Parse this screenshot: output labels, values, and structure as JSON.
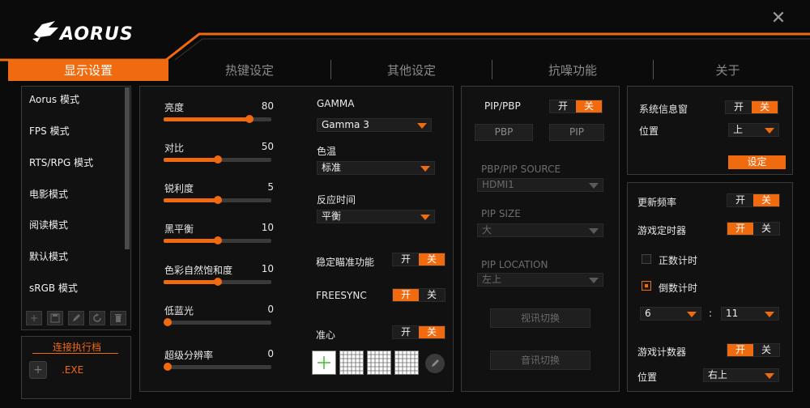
{
  "app": {
    "logo": "AORUS",
    "close_icon": "✕"
  },
  "tabs": [
    {
      "label": "显示设置",
      "active": true
    },
    {
      "label": "热键设定",
      "active": false
    },
    {
      "label": "其他设定",
      "active": false
    },
    {
      "label": "抗噪功能",
      "active": false
    },
    {
      "label": "关于",
      "active": false
    }
  ],
  "modes": [
    "Aorus 模式",
    "FPS 模式",
    "RTS/RPG 模式",
    "电影模式",
    "阅读模式",
    "默认模式",
    "sRGB 模式"
  ],
  "mode_tools": [
    "+",
    "save-icon",
    "edit-icon",
    "reset-icon",
    "delete-icon"
  ],
  "exec_link": {
    "title": "连接执行档",
    "exe": ".EXE",
    "add_icon": "+"
  },
  "sliders": [
    {
      "label": "亮度",
      "value": "80",
      "level": 0.8
    },
    {
      "label": "对比",
      "value": "50",
      "level": 0.5
    },
    {
      "label": "锐利度",
      "value": "5",
      "level": 0.5
    },
    {
      "label": "黑平衡",
      "value": "10",
      "level": 0.5
    },
    {
      "label": "色彩自然饱和度",
      "value": "10",
      "level": 0.5
    },
    {
      "label": "低蓝光",
      "value": "0",
      "level": 0.0
    },
    {
      "label": "超级分辨率",
      "value": "0",
      "level": 0.0
    }
  ],
  "gamma": {
    "label": "GAMMA",
    "value": "Gamma 3"
  },
  "color_temp": {
    "label": "色温",
    "value": "标准"
  },
  "response": {
    "label": "反应时间",
    "value": "平衡"
  },
  "stabilizer": {
    "label": "稳定瞄准功能",
    "on": "开",
    "off": "关",
    "state": "off"
  },
  "freesync": {
    "label": "FREESYNC",
    "on": "开",
    "off": "关",
    "state": "on"
  },
  "crosshair": {
    "label": "准心",
    "on": "开",
    "off": "关",
    "state": "off"
  },
  "pip": {
    "label": "PIP/PBP",
    "on": "开",
    "off": "关",
    "state": "off",
    "pbp_button": "PBP",
    "pip_button": "PIP",
    "source_label": "PBP/PIP SOURCE",
    "source_value": "HDMI1",
    "size_label": "PIP SIZE",
    "size_value": "大",
    "location_label": "PIP LOCATION",
    "location_value": "左上",
    "video_switch": "视讯切换",
    "audio_switch": "音讯切换"
  },
  "sysinfo": {
    "label": "系统信息窗",
    "on": "开",
    "off": "关",
    "state": "off",
    "position_label": "位置",
    "position_value": "上",
    "settings_button": "设定"
  },
  "refresh": {
    "label": "更新频率",
    "on": "开",
    "off": "关",
    "state": "off"
  },
  "game_timer": {
    "label": "游戏定时器",
    "on": "开",
    "off": "关",
    "state": "on",
    "countup_label": "正数计时",
    "countdown_label": "倒数计时",
    "minutes": "6",
    "colon": ":",
    "seconds": "11"
  },
  "game_counter": {
    "label": "游戏计数器",
    "on": "开",
    "off": "关",
    "state": "on",
    "position_label": "位置",
    "position_value": "右上"
  },
  "colors": {
    "accent": "#f06a0f",
    "panel_border": "#3a3a3a",
    "bg": "#0b0b0b"
  }
}
